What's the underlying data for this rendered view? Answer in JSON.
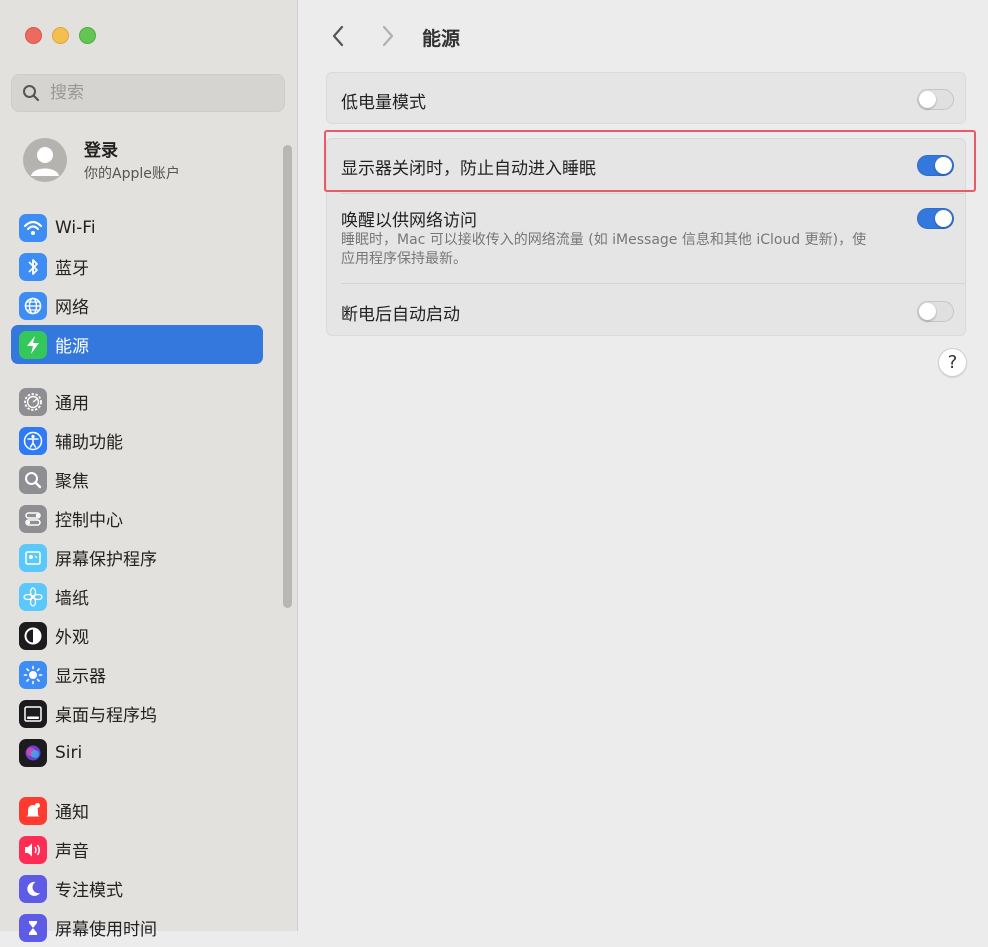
{
  "sidebar": {
    "search_placeholder": "搜索",
    "account": {
      "name": "登录",
      "subtitle": "你的Apple账户"
    },
    "items": [
      {
        "label": "Wi-Fi",
        "icon": "wifi-icon",
        "color": "#3d8df5"
      },
      {
        "label": "蓝牙",
        "icon": "bluetooth-icon",
        "color": "#3d8df5"
      },
      {
        "label": "网络",
        "icon": "globe-icon",
        "color": "#3d8df5"
      },
      {
        "label": "能源",
        "icon": "energy-bolt-icon",
        "color": "#34c759"
      },
      {
        "label": "通用",
        "icon": "gear-icon",
        "color": "#8e8e93"
      },
      {
        "label": "辅助功能",
        "icon": "accessibility-icon",
        "color": "#2f7bf5"
      },
      {
        "label": "聚焦",
        "icon": "magnifier-icon",
        "color": "#8e8e93"
      },
      {
        "label": "控制中心",
        "icon": "control-center-icon",
        "color": "#8e8e93"
      },
      {
        "label": "屏幕保护程序",
        "icon": "screensaver-icon",
        "color": "#5ac8fa"
      },
      {
        "label": "墙纸",
        "icon": "wallpaper-flower-icon",
        "color": "#5ac8fa"
      },
      {
        "label": "外观",
        "icon": "appearance-icon",
        "color": "#1c1c1e"
      },
      {
        "label": "显示器",
        "icon": "sun-icon",
        "color": "#3d8df5"
      },
      {
        "label": "桌面与程序坞",
        "icon": "dock-icon",
        "color": "#1c1c1e"
      },
      {
        "label": "Siri",
        "icon": "siri-icon",
        "color": "#1c1c1e"
      },
      {
        "label": "通知",
        "icon": "bell-icon",
        "color": "#ff3b30"
      },
      {
        "label": "声音",
        "icon": "speaker-icon",
        "color": "#ff2d55"
      },
      {
        "label": "专注模式",
        "icon": "moon-icon",
        "color": "#5e5ce6"
      },
      {
        "label": "屏幕使用时间",
        "icon": "hourglass-icon",
        "color": "#5e5ce6"
      }
    ]
  },
  "main": {
    "title": "能源",
    "settings": {
      "low_power": {
        "label": "低电量模式",
        "on": false
      },
      "prevent_sleep": {
        "label": "显示器关闭时，防止自动进入睡眠",
        "on": true
      },
      "wake_network": {
        "label": "唤醒以供网络访问",
        "desc_line1": "睡眠时，Mac 可以接收传入的网络流量 (如 iMessage 信息和其他 iCloud 更新)，使",
        "desc_line2": "应用程序保持最新。",
        "on": true
      },
      "power_failure": {
        "label": "断电后自动启动",
        "on": false
      }
    },
    "help_label": "?"
  }
}
